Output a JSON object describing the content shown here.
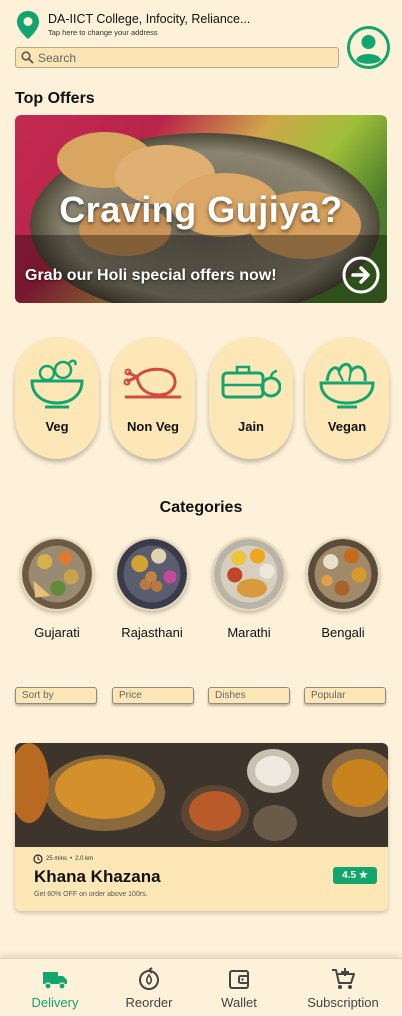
{
  "header": {
    "address_title": "DA-IICT College, Infocity, Reliance...",
    "address_subtitle": "Tap here to change your address",
    "search_placeholder": "Search",
    "icons": {
      "location": "map-pin-icon",
      "search": "search-icon",
      "profile": "user-icon"
    }
  },
  "top_offers": {
    "title": "Top Offers",
    "banner": {
      "headline": "Craving Gujiya?",
      "subtext": "Grab our Holi special offers now!",
      "icon": "arrow-right-icon"
    }
  },
  "diet_filters": [
    {
      "label": "Veg",
      "icon": "veg-bowl-icon"
    },
    {
      "label": "Non Veg",
      "icon": "meat-leg-icon"
    },
    {
      "label": "Jain",
      "icon": "lunchbox-apple-icon"
    },
    {
      "label": "Vegan",
      "icon": "salad-bowl-icon"
    }
  ],
  "categories": {
    "title": "Categories",
    "items": [
      {
        "label": "Gujarati"
      },
      {
        "label": "Rajasthani"
      },
      {
        "label": "Marathi"
      },
      {
        "label": "Bengali"
      }
    ]
  },
  "filters": [
    {
      "placeholder": "Sort by"
    },
    {
      "placeholder": "Price"
    },
    {
      "placeholder": "Dishes"
    },
    {
      "placeholder": "Popular"
    }
  ],
  "restaurant": {
    "meta_time": "25 mins",
    "meta_distance": "2.0 km",
    "name": "Khana Khazana",
    "rating": "4.5 ★",
    "offer": "Get 60% OFF on order above 100rs."
  },
  "bottom_nav": [
    {
      "label": "Delivery",
      "icon": "truck-icon",
      "active": true
    },
    {
      "label": "Reorder",
      "icon": "reorder-icon",
      "active": false
    },
    {
      "label": "Wallet",
      "icon": "wallet-icon",
      "active": false
    },
    {
      "label": "Subscription",
      "icon": "cart-plus-icon",
      "active": false
    }
  ],
  "colors": {
    "background": "#fdf1d9",
    "accent": "#12a56e",
    "card": "#fde7b7",
    "nonveg_red": "#d24b3e"
  }
}
